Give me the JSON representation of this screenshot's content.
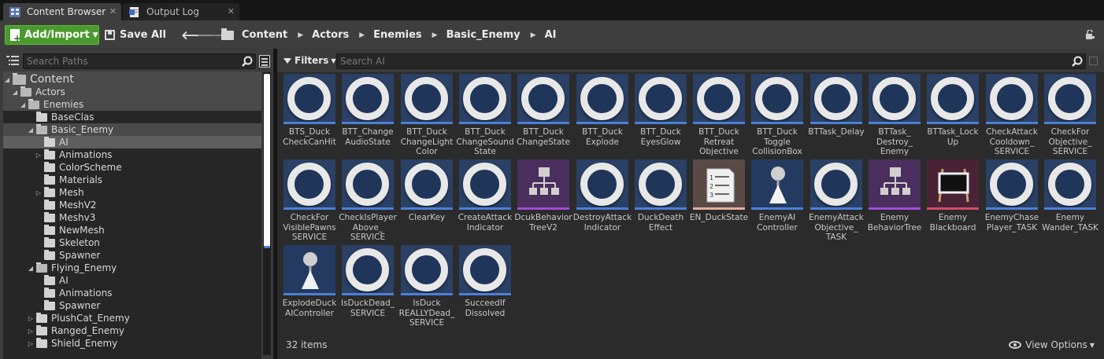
{
  "tabs": [
    {
      "label": "Content Browser",
      "active": true
    },
    {
      "label": "Output Log",
      "active": false
    }
  ],
  "toolbar": {
    "add_import_label": "Add/Import",
    "save_all_label": "Save All",
    "breadcrumbs": [
      "Content",
      "Actors",
      "Enemies",
      "Basic_Enemy",
      "AI"
    ]
  },
  "sources": {
    "search_placeholder": "Search Paths",
    "tree": [
      {
        "label": "Content",
        "depth": 0,
        "expanded": true,
        "big": true,
        "state": "hl"
      },
      {
        "label": "Actors",
        "depth": 1,
        "expanded": true,
        "state": "hl"
      },
      {
        "label": "Enemies",
        "depth": 2,
        "expanded": true,
        "state": "hl"
      },
      {
        "label": "BaseClas",
        "depth": 3,
        "state": ""
      },
      {
        "label": "Basic_Enemy",
        "depth": 3,
        "expanded": true,
        "state": "hl"
      },
      {
        "label": "AI",
        "depth": 4,
        "state": "sel"
      },
      {
        "label": "Animations",
        "depth": 4,
        "collapsed": true,
        "state": ""
      },
      {
        "label": "ColorScheme",
        "depth": 4,
        "state": ""
      },
      {
        "label": "Materials",
        "depth": 4,
        "state": ""
      },
      {
        "label": "Mesh",
        "depth": 4,
        "collapsed": true,
        "state": ""
      },
      {
        "label": "MeshV2",
        "depth": 4,
        "state": ""
      },
      {
        "label": "Meshv3",
        "depth": 4,
        "state": ""
      },
      {
        "label": "NewMesh",
        "depth": 4,
        "state": ""
      },
      {
        "label": "Skeleton",
        "depth": 4,
        "state": ""
      },
      {
        "label": "Spawner",
        "depth": 4,
        "state": ""
      },
      {
        "label": "Flying_Enemy",
        "depth": 3,
        "expanded": true,
        "state": ""
      },
      {
        "label": "AI",
        "depth": 4,
        "state": ""
      },
      {
        "label": "Animations",
        "depth": 4,
        "state": ""
      },
      {
        "label": "Spawner",
        "depth": 4,
        "state": ""
      },
      {
        "label": "PlushCat_Enemy",
        "depth": 3,
        "collapsed": true,
        "state": ""
      },
      {
        "label": "Ranged_Enemy",
        "depth": 3,
        "collapsed": true,
        "state": ""
      },
      {
        "label": "Shield_Enemy",
        "depth": 3,
        "collapsed": true,
        "state": ""
      }
    ]
  },
  "assets_panel": {
    "filters_label": "Filters",
    "search_placeholder": "Search AI",
    "item_count": "32 items",
    "view_options_label": "View Options",
    "assets": [
      {
        "label": "BTS_Duck\nCheckCanHit",
        "kind": "blueprint"
      },
      {
        "label": "BTT_Change\nAudioState",
        "kind": "blueprint"
      },
      {
        "label": "BTT_Duck\nChangeLight\nColor",
        "kind": "blueprint"
      },
      {
        "label": "BTT_Duck\nChangeSound\nState",
        "kind": "blueprint"
      },
      {
        "label": "BTT_Duck\nChangeState",
        "kind": "blueprint"
      },
      {
        "label": "BTT_Duck\nExplode",
        "kind": "blueprint"
      },
      {
        "label": "BTT_Duck\nEyesGlow",
        "kind": "blueprint"
      },
      {
        "label": "BTT_Duck\nRetreat\nObjective",
        "kind": "blueprint"
      },
      {
        "label": "BTT_Duck\nToggle\nCollisionBox",
        "kind": "blueprint"
      },
      {
        "label": "BTTask_Delay",
        "kind": "blueprint"
      },
      {
        "label": "BTTask_\nDestroy_\nEnemy",
        "kind": "blueprint"
      },
      {
        "label": "BTTask_Lock\nUp",
        "kind": "blueprint"
      },
      {
        "label": "CheckAttack\nCooldown_\nSERVICE",
        "kind": "blueprint"
      },
      {
        "label": "CheckFor\nObjective_\nSERVICE",
        "kind": "blueprint"
      },
      {
        "label": "CheckFor\nVisiblePawns\nSERVICE",
        "kind": "blueprint"
      },
      {
        "label": "CheckIsPlayer\nAbove_\nSERVICE",
        "kind": "blueprint"
      },
      {
        "label": "ClearKey",
        "kind": "blueprint"
      },
      {
        "label": "CreateAttack\nIndicator",
        "kind": "blueprint"
      },
      {
        "label": "DcukBehavior\nTreeV2",
        "kind": "behavior-tree"
      },
      {
        "label": "DestroyAttack\nIndicator",
        "kind": "blueprint"
      },
      {
        "label": "DuckDeath\nEffect",
        "kind": "blueprint"
      },
      {
        "label": "EN_DuckState",
        "kind": "enum"
      },
      {
        "label": "EnemyAI\nController",
        "kind": "controller"
      },
      {
        "label": "EnemyAttack\nObjective_\nTASK",
        "kind": "blueprint"
      },
      {
        "label": "Enemy\nBehaviorTree",
        "kind": "behavior-tree"
      },
      {
        "label": "Enemy\nBlackboard",
        "kind": "blackboard"
      },
      {
        "label": "EnemyChase\nPlayer_TASK",
        "kind": "blueprint"
      },
      {
        "label": "Enemy\nWander_TASK",
        "kind": "blueprint"
      },
      {
        "label": "ExplodeDuck\nAIController",
        "kind": "controller"
      },
      {
        "label": "IsDuckDead_\nSERVICE",
        "kind": "blueprint"
      },
      {
        "label": "IsDuck\nREALLYDead_\nSERVICE",
        "kind": "blueprint"
      },
      {
        "label": "SucceedIf\nDissolved",
        "kind": "blueprint"
      }
    ]
  }
}
